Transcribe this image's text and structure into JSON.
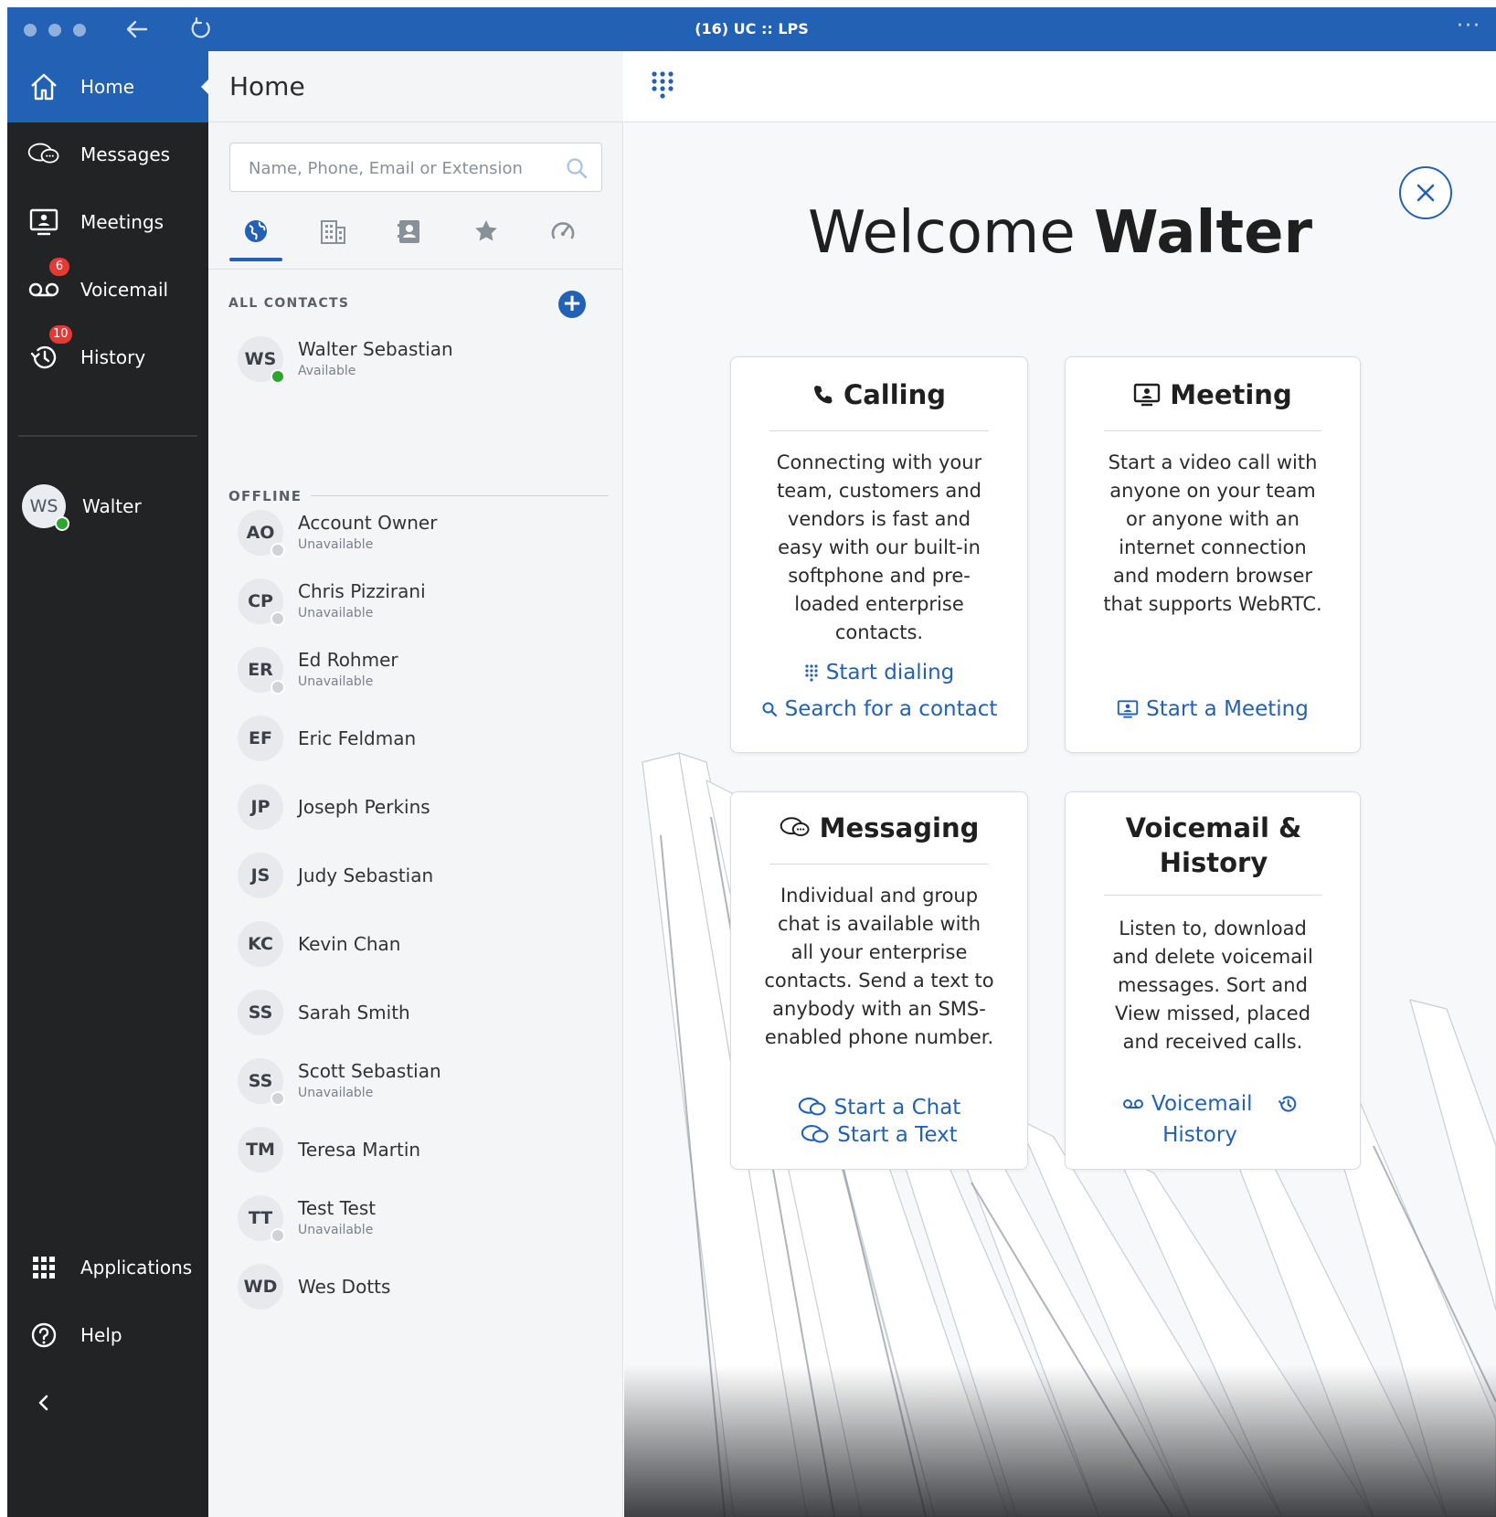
{
  "window": {
    "title": "(16) UC :: LPS",
    "more": "···"
  },
  "nav": {
    "items": [
      {
        "label": "Home",
        "icon": "home-icon"
      },
      {
        "label": "Messages",
        "icon": "messages-icon"
      },
      {
        "label": "Meetings",
        "icon": "meetings-icon"
      },
      {
        "label": "Voicemail",
        "icon": "voicemail-icon",
        "badge": "6"
      },
      {
        "label": "History",
        "icon": "history-icon",
        "badge": "10"
      }
    ],
    "user": {
      "initials": "WS",
      "name": "Walter"
    },
    "bottom": [
      {
        "label": "Applications",
        "icon": "applications-icon"
      },
      {
        "label": "Help",
        "icon": "help-icon"
      }
    ]
  },
  "contacts": {
    "title": "Home",
    "search_placeholder": "Name, Phone, Email or Extension",
    "tabs": [
      "globe-icon",
      "building-icon",
      "contact-card-icon",
      "star-icon",
      "speed-dial-icon"
    ],
    "all_label": "ALL CONTACTS",
    "offline_label": "OFFLINE",
    "online": [
      {
        "initials": "WS",
        "name": "Walter Sebastian",
        "status": "Available"
      }
    ],
    "offline": [
      {
        "initials": "AO",
        "name": "Account Owner",
        "status": "Unavailable"
      },
      {
        "initials": "CP",
        "name": "Chris Pizzirani",
        "status": "Unavailable"
      },
      {
        "initials": "ER",
        "name": "Ed Rohmer",
        "status": "Unavailable"
      },
      {
        "initials": "EF",
        "name": "Eric Feldman",
        "status": ""
      },
      {
        "initials": "JP",
        "name": "Joseph Perkins",
        "status": ""
      },
      {
        "initials": "JS",
        "name": "Judy Sebastian",
        "status": ""
      },
      {
        "initials": "KC",
        "name": "Kevin Chan",
        "status": ""
      },
      {
        "initials": "SS",
        "name": "Sarah Smith",
        "status": ""
      },
      {
        "initials": "SS",
        "name": "Scott Sebastian",
        "status": "Unavailable"
      },
      {
        "initials": "TM",
        "name": "Teresa Martin",
        "status": ""
      },
      {
        "initials": "TT",
        "name": "Test Test",
        "status": "Unavailable"
      },
      {
        "initials": "WD",
        "name": "Wes Dotts",
        "status": ""
      }
    ]
  },
  "welcome": {
    "prefix": "Welcome",
    "name": "Walter"
  },
  "cards": {
    "calling": {
      "title": "Calling",
      "body": "Connecting with your team, customers and vendors is fast and easy with our built-in softphone and pre-loaded enterprise contacts.",
      "link1": "Start dialing",
      "link2": "Search for a contact"
    },
    "meeting": {
      "title": "Meeting",
      "body": "Start a video call with anyone on your team or anyone with an internet connection and modern browser that supports WebRTC.",
      "link1": "Start a Meeting"
    },
    "messaging": {
      "title": "Messaging",
      "body": "Individual and group chat is available with all your enterprise contacts. Send a text to anybody with an SMS-enabled phone number.",
      "link1": "Start a Chat",
      "link2": "Start a Text"
    },
    "voicemail": {
      "title": "Voicemail & History",
      "body": "Listen to, download and delete voicemail messages. Sort and View missed, placed and received calls.",
      "link1": "Voicemail",
      "link2": "History"
    }
  },
  "colors": {
    "accent": "#2261b3",
    "nav_bg": "#222325",
    "online": "#2fa52f",
    "badge": "#e53935"
  }
}
